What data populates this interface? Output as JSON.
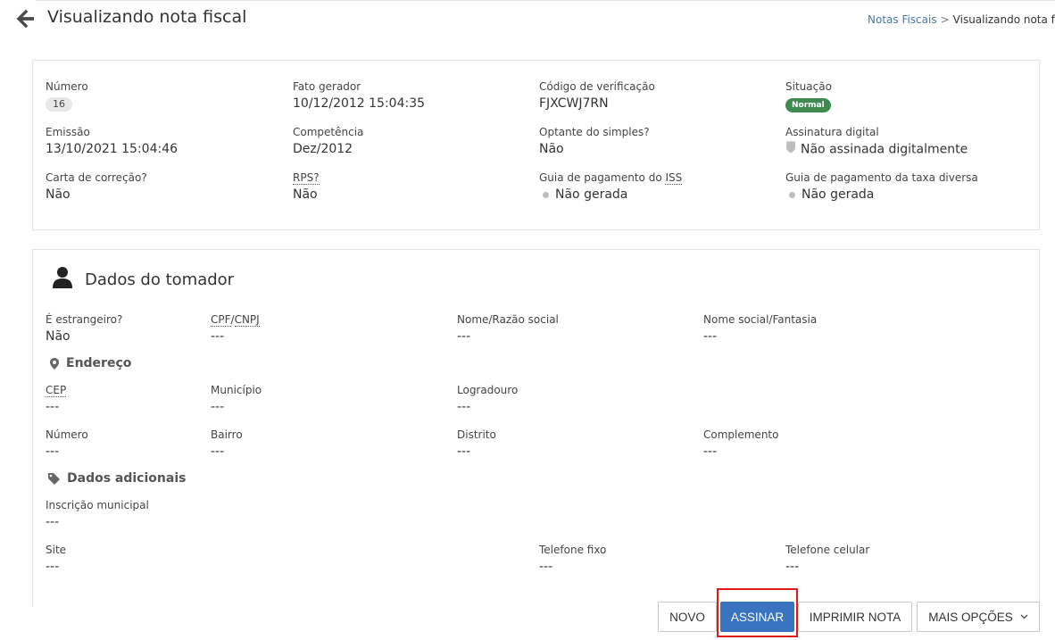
{
  "header": {
    "title": "Visualizando nota fiscal",
    "breadcrumb": {
      "link": "Notas Fiscais",
      "separator": ">",
      "current": "Visualizando nota fisc"
    }
  },
  "summary": {
    "numero": {
      "label": "Número",
      "value": "16"
    },
    "fato_gerador": {
      "label": "Fato gerador",
      "value": "10/12/2012 15:04:35"
    },
    "codigo": {
      "label": "Código de verificação",
      "value": "FJXCWJ7RN"
    },
    "situacao": {
      "label": "Situação",
      "value": "Normal",
      "color": "#3f8b4f"
    },
    "emissao": {
      "label": "Emissão",
      "value": "13/10/2021 15:04:46"
    },
    "competencia": {
      "label": "Competência",
      "value": "Dez/2012"
    },
    "optante": {
      "label": "Optante do simples?",
      "value": "Não"
    },
    "assinatura": {
      "label": "Assinatura digital",
      "value": "Não assinada digitalmente"
    },
    "carta": {
      "label": "Carta de correção?",
      "value": "Não"
    },
    "rps": {
      "label": "RPS?",
      "value": "Não"
    },
    "guia_iss": {
      "label_prefix": "Guia de pagamento do ",
      "label_abbr": "ISS",
      "value": "Não gerada"
    },
    "guia_taxa": {
      "label": "Guia de pagamento da taxa diversa",
      "value": "Não gerada"
    }
  },
  "tomador": {
    "title": "Dados do tomador",
    "estrangeiro": {
      "label": "É estrangeiro?",
      "value": "Não"
    },
    "cpf_cnpj": {
      "label_a": "CPF",
      "sep": "/",
      "label_b": "CNPJ",
      "value": "---"
    },
    "nome": {
      "label": "Nome/Razão social",
      "value": "---"
    },
    "nome_social": {
      "label": "Nome social/Fantasia",
      "value": "---"
    },
    "endereco_title": "Endereço",
    "cep": {
      "label": "CEP",
      "value": "---"
    },
    "municipio": {
      "label": "Município",
      "value": "---"
    },
    "logradouro": {
      "label": "Logradouro",
      "value": "---"
    },
    "numero": {
      "label": "Número",
      "value": "---"
    },
    "bairro": {
      "label": "Bairro",
      "value": "---"
    },
    "distrito": {
      "label": "Distrito",
      "value": "---"
    },
    "complemento": {
      "label": "Complemento",
      "value": "---"
    },
    "adicionais_title": "Dados adicionais",
    "inscricao": {
      "label": "Inscrição municipal",
      "value": "---"
    },
    "site": {
      "label": "Site",
      "value": "---"
    },
    "tel_fixo": {
      "label": "Telefone fixo",
      "value": "---"
    },
    "tel_celular": {
      "label": "Telefone celular",
      "value": "---"
    }
  },
  "actions": {
    "novo": "NOVO",
    "assinar": "ASSINAR",
    "imprimir": "IMPRIMIR NOTA",
    "mais": "MAIS OPÇÕES"
  },
  "colors": {
    "primary": "#3a74c1",
    "link": "#4a78a8",
    "highlight": "#e01818"
  }
}
